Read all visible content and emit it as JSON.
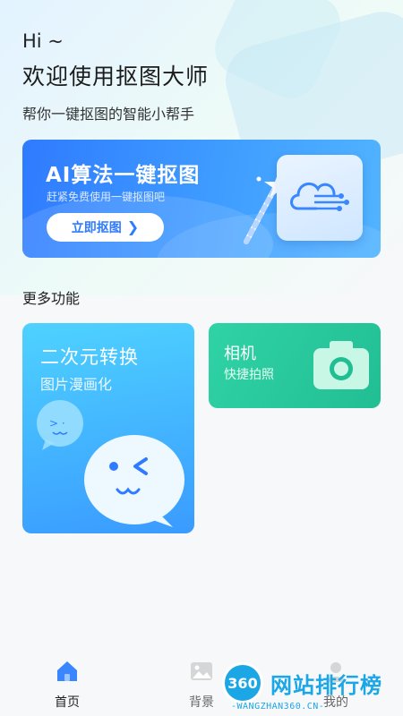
{
  "header": {
    "greeting": "Hi ~",
    "title": "欢迎使用抠图大师",
    "subtitle": "帮你一键抠图的智能小帮手"
  },
  "banner": {
    "title": "AI算法一键抠图",
    "subtitle": "赶紧免费使用一键抠图吧",
    "button_label": "立即抠图",
    "button_chevron": "❯",
    "accent": "#2f7bff"
  },
  "more": {
    "section_title": "更多功能",
    "cards": [
      {
        "title": "二次元转换",
        "subtitle": "图片漫画化",
        "icon": "chat-bubble-face-icon",
        "color": "#3a9bff"
      },
      {
        "title": "相机",
        "subtitle": "快捷拍照",
        "icon": "camera-icon",
        "color": "#22be93"
      }
    ]
  },
  "tabbar": {
    "items": [
      {
        "label": "首页",
        "icon": "home-icon",
        "active": true
      },
      {
        "label": "背景",
        "icon": "image-icon",
        "active": false
      },
      {
        "label": "我的",
        "icon": "user-icon",
        "active": false
      }
    ]
  },
  "watermark": {
    "badge": "360",
    "text": "网站排行榜",
    "url": "-WANGZHAN360.CN-"
  }
}
